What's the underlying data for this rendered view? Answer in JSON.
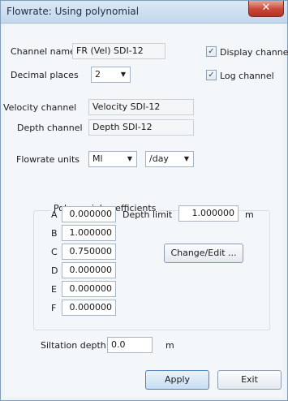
{
  "window": {
    "title": "Flowrate: Using polynomial",
    "close_label": "✕"
  },
  "channel_name": {
    "label": "Channel name",
    "value": "FR (Vel) SDI-12"
  },
  "decimal_places": {
    "label": "Decimal places",
    "value": "2"
  },
  "display_channel": {
    "label": "Display channel",
    "checked": true
  },
  "log_channel": {
    "label": "Log channel",
    "checked": true
  },
  "velocity_channel": {
    "label": "Velocity channel",
    "value": "Velocity SDI-12"
  },
  "depth_channel": {
    "label": "Depth channel",
    "value": "Depth SDI-12"
  },
  "flowrate_units": {
    "label": "Flowrate units",
    "unit": "Ml",
    "per": "/day"
  },
  "polynomial": {
    "title": "Polynomial coefficients",
    "coefficients": [
      {
        "name": "A",
        "value": "0.000000"
      },
      {
        "name": "B",
        "value": "1.000000"
      },
      {
        "name": "C",
        "value": "0.750000"
      },
      {
        "name": "D",
        "value": "0.000000"
      },
      {
        "name": "E",
        "value": "0.000000"
      },
      {
        "name": "F",
        "value": "0.000000"
      }
    ],
    "depth_limit": {
      "label": "Depth limit",
      "value": "1.000000",
      "unit": "m"
    },
    "change_button": "Change/Edit ..."
  },
  "siltation": {
    "label": "Siltation depth",
    "value": "0.0",
    "unit": "m"
  },
  "buttons": {
    "apply": "Apply",
    "exit": "Exit"
  },
  "colors": {
    "close": "#c9473a",
    "window_bg": "#f4f7fa",
    "border": "#7f9db9"
  }
}
